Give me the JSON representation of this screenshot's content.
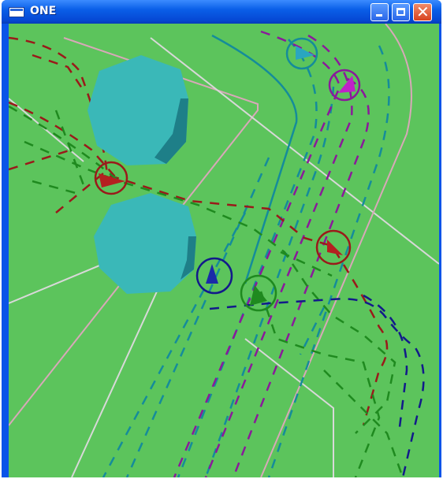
{
  "window": {
    "title": "ONE",
    "buttons": {
      "minimize": "minimize",
      "maximize": "maximize",
      "close": "close"
    }
  },
  "icons": {
    "app": "window-app-icon",
    "minimize": "minimize-icon",
    "maximize": "maximize-icon",
    "close": "close-icon"
  },
  "colors": {
    "ground": "#5cc45c",
    "pillar": "#3ab8b8",
    "path_red": "#9a1a1a",
    "path_green": "#1f8a1f",
    "path_teal": "#158c9a",
    "path_purple": "#8a1a9a",
    "path_blue": "#121a8a",
    "lane_pink": "#d8a8b8",
    "lane_white": "#d8d8d8",
    "title_bar": "#0a54e8"
  }
}
